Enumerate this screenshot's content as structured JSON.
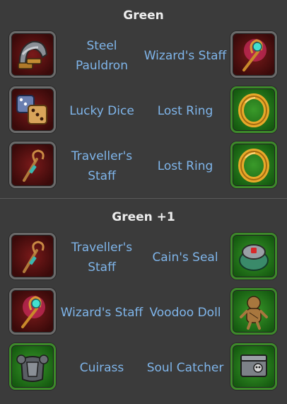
{
  "sections": [
    {
      "title": "Green",
      "rows": [
        {
          "left": {
            "name": "Steel Pauldron",
            "icon": "steel-pauldron-icon"
          },
          "right": {
            "name": "Wizard's Staff",
            "icon": "wizards-staff-icon"
          }
        },
        {
          "left": {
            "name": "Lucky Dice",
            "icon": "lucky-dice-icon"
          },
          "right": {
            "name": "Lost Ring",
            "icon": "lost-ring-icon"
          }
        },
        {
          "left": {
            "name": "Traveller's Staff",
            "icon": "travellers-staff-icon"
          },
          "right": {
            "name": "Lost Ring",
            "icon": "lost-ring-icon"
          }
        }
      ]
    },
    {
      "title": "Green +1",
      "rows": [
        {
          "left": {
            "name": "Traveller's Staff",
            "icon": "travellers-staff-icon"
          },
          "right": {
            "name": "Cain's Seal",
            "icon": "cains-seal-icon"
          }
        },
        {
          "left": {
            "name": "Wizard's Staff",
            "icon": "wizards-staff-icon"
          },
          "right": {
            "name": "Voodoo Doll",
            "icon": "voodoo-doll-icon"
          }
        },
        {
          "left": {
            "name": "Cuirass",
            "icon": "cuirass-icon"
          },
          "right": {
            "name": "Soul Catcher",
            "icon": "soul-catcher-icon"
          }
        }
      ]
    }
  ],
  "colors": {
    "item_name": "#7fb5ea",
    "title": "#ededed",
    "background": "#3b3b3b",
    "green_frame": "#3d8a2a"
  }
}
